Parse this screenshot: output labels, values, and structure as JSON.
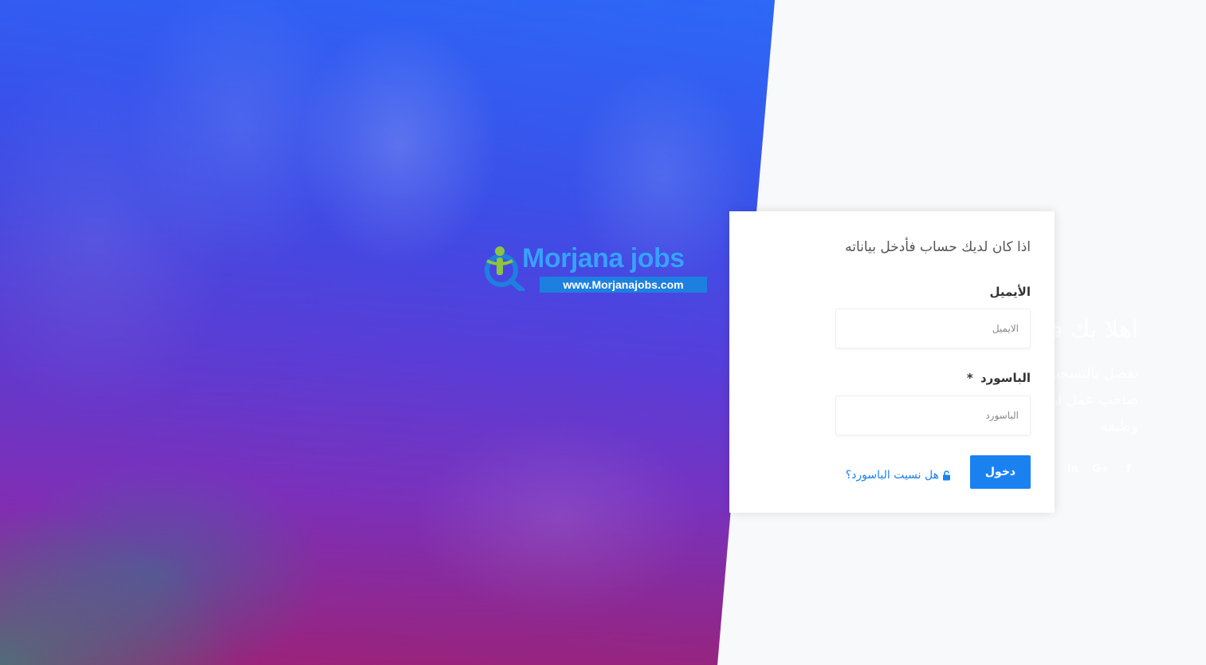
{
  "hero": {
    "logo_name": "Morjana jobs",
    "logo_url": "www.Morjanajobs.com",
    "title": "اهلا بك في موقعنا",
    "description": "تفضل بالتسجيل معنا وقم بعرض وظائفك اذا كنت صاحب عمل او برفع سيرتك الذاتيه اذا كنت طالب وظيفة",
    "social": [
      {
        "icon": "facebook-icon",
        "glyph": "f"
      },
      {
        "icon": "google-plus-icon",
        "glyph": "G+"
      },
      {
        "icon": "linkedin-icon",
        "glyph": "in"
      },
      {
        "icon": "instagram-icon",
        "glyph": "◎"
      },
      {
        "icon": "twitter-icon",
        "glyph": "🐦"
      }
    ]
  },
  "login": {
    "heading": "اذا كان لديك حساب فأدخل بياناته",
    "email_label": "الأيميل",
    "email_placeholder": "الايميل",
    "password_label": "الباسورد",
    "password_required": "*",
    "password_placeholder": "الباسورد",
    "submit_label": "دخول",
    "forgot_label": "هل نسيت الباسورد؟"
  },
  "colors": {
    "accent": "#1a82f0",
    "hero_top": "#2f5ff2",
    "hero_bottom": "#a0236f"
  }
}
